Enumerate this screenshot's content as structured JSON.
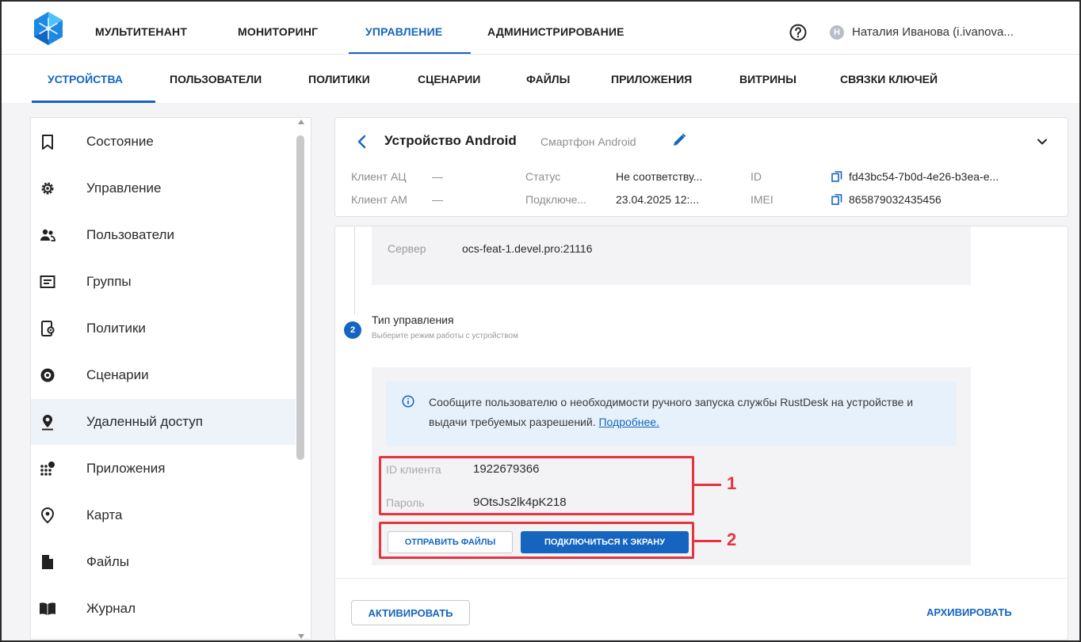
{
  "top_nav": {
    "items": [
      {
        "label": "МУЛЬТИТЕНАНТ",
        "active": false
      },
      {
        "label": "МОНИТОРИНГ",
        "active": false
      },
      {
        "label": "УПРАВЛЕНИЕ",
        "active": true
      },
      {
        "label": "АДМИНИСТРИРОВАНИЕ",
        "active": false
      }
    ],
    "user_initial": "Н",
    "user_name": "Наталия Иванова (i.ivanova...",
    "help_icon": "help-circle-icon"
  },
  "sub_nav": {
    "items": [
      {
        "label": "УСТРОЙСТВА",
        "active": true
      },
      {
        "label": "ПОЛЬЗОВАТЕЛИ",
        "active": false
      },
      {
        "label": "ПОЛИТИКИ",
        "active": false
      },
      {
        "label": "СЦЕНАРИИ",
        "active": false
      },
      {
        "label": "ФАЙЛЫ",
        "active": false
      },
      {
        "label": "ПРИЛОЖЕНИЯ",
        "active": false
      },
      {
        "label": "ВИТРИНЫ",
        "active": false
      },
      {
        "label": "СВЯЗКИ КЛЮЧЕЙ",
        "active": false
      }
    ]
  },
  "sidebar": {
    "items": [
      {
        "label": "Состояние",
        "icon": "bookmark-icon",
        "active": false
      },
      {
        "label": "Управление",
        "icon": "gear-icon",
        "active": false
      },
      {
        "label": "Пользователи",
        "icon": "users-icon",
        "active": false
      },
      {
        "label": "Группы",
        "icon": "folder-list-icon",
        "active": false
      },
      {
        "label": "Политики",
        "icon": "policy-device-icon",
        "active": false
      },
      {
        "label": "Сценарии",
        "icon": "scenario-icon",
        "active": false
      },
      {
        "label": "Удаленный доступ",
        "icon": "remote-access-icon",
        "active": true
      },
      {
        "label": "Приложения",
        "icon": "apps-grid-icon",
        "active": false
      },
      {
        "label": "Карта",
        "icon": "map-pin-icon",
        "active": false
      },
      {
        "label": "Файлы",
        "icon": "file-icon",
        "active": false
      },
      {
        "label": "Журнал",
        "icon": "book-icon",
        "active": false
      }
    ]
  },
  "device": {
    "title": "Устройство Android",
    "subtitle": "Смартфон Android",
    "client_ac_label": "Клиент АЦ",
    "client_ac_value": "—",
    "client_am_label": "Клиент АМ",
    "client_am_value": "—",
    "status_label": "Статус",
    "status_value": "Не соответству...",
    "connected_label": "Подключе...",
    "connected_value": "23.04.2025 12:...",
    "id_label": "ID",
    "id_value": "fd43bc54-7b0d-4e26-b3ea-e...",
    "imei_label": "IMEI",
    "imei_value": "865879032435456"
  },
  "server": {
    "label": "Сервер",
    "value": "ocs-feat-1.devel.pro:21116"
  },
  "step": {
    "number": "2",
    "title": "Тип управления",
    "description": "Выберите режим работы с устройством"
  },
  "info": {
    "text": "Сообщите пользователю о необходимости ручного запуска службы RustDesk на устройстве и выдачи требуемых разрешений.",
    "link": "Подробнее."
  },
  "credentials": {
    "client_id_label": "ID клиента",
    "client_id_value": "1922679366",
    "password_label": "Пароль",
    "password_value": "9OtsJs2lk4pK218"
  },
  "actions": {
    "send_files": "ОТПРАВИТЬ ФАЙЛЫ",
    "connect_screen": "ПОДКЛЮЧИТЬСЯ К ЭКРАНУ",
    "activate": "АКТИВИРОВАТЬ",
    "archive": "АРХИВИРОВАТЬ"
  },
  "annotations": {
    "first": "1",
    "second": "2"
  },
  "colors": {
    "accent": "#1565c0",
    "annotation": "#e5343f",
    "active_row": "#eef3fa",
    "info_background": "#e6f1fb"
  }
}
